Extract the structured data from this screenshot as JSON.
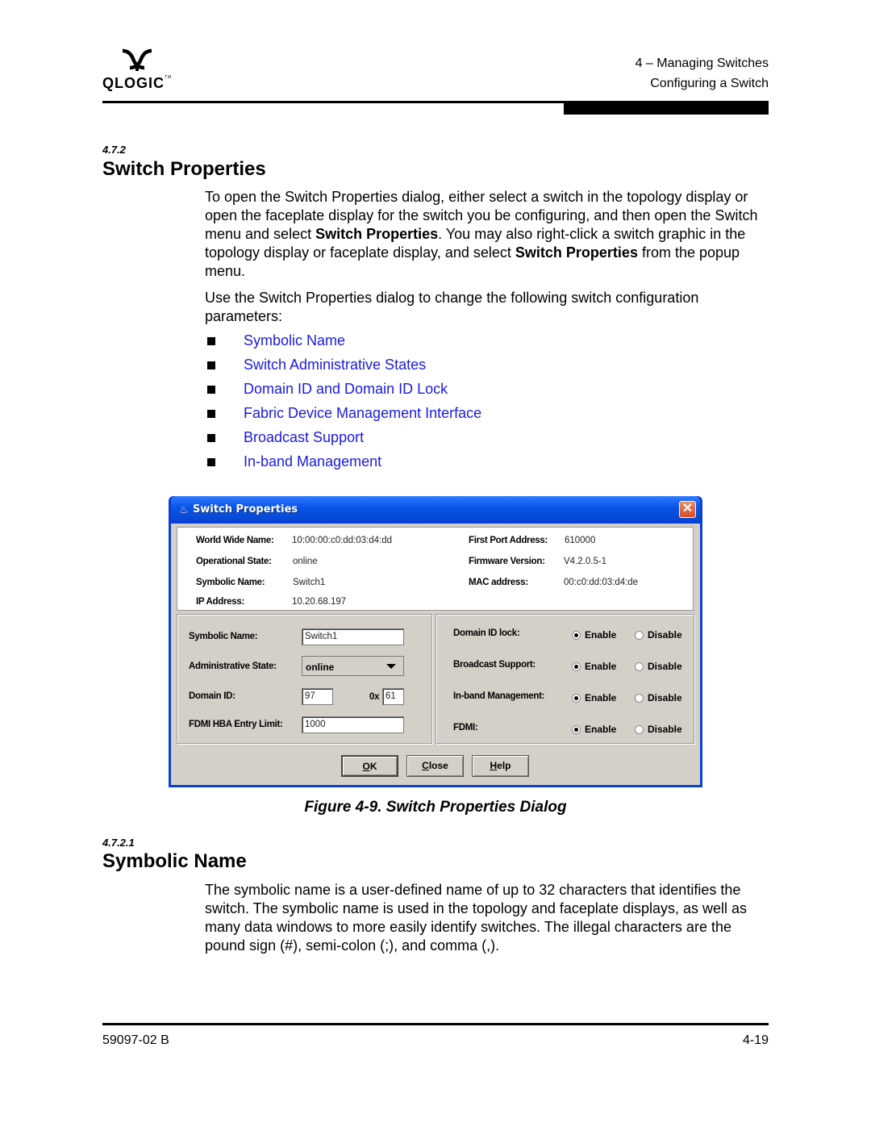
{
  "header": {
    "logo_text": "QLOGIC",
    "logo_tm": "TM",
    "chapter": "4 – Managing Switches",
    "section": "Configuring a Switch"
  },
  "section1": {
    "number": "4.7.2",
    "title": "Switch Properties",
    "para1": {
      "t1": "To open the Switch Properties dialog, either select a switch in the topology display or open the faceplate display for the switch you be configuring, and then open the Switch menu and select ",
      "b1": "Switch Properties",
      "t2": ". You may also right-click a switch graphic in the topology display or faceplate display, and select ",
      "b2": "Switch Properties",
      "t3": " from the popup menu."
    },
    "para2": "Use the Switch Properties dialog to change the following switch configuration parameters:",
    "links": [
      "Symbolic Name",
      "Switch Administrative States",
      "Domain ID and Domain ID Lock",
      "Fabric Device Management Interface",
      "Broadcast Support",
      "In-band Management"
    ],
    "link_color": "#1a1ae6"
  },
  "dialog": {
    "title": "Switch Properties",
    "info": {
      "wwn_label": "World Wide Name:",
      "wwn_value": "10:00:00:c0:dd:03:d4:dd",
      "opstate_label": "Operational State:",
      "opstate_value": "online",
      "symname_label": "Symbolic Name:",
      "symname_value": "Switch1",
      "ip_label": "IP Address:",
      "ip_value": "10.20.68.197",
      "fpa_label": "First Port Address:",
      "fpa_value": "610000",
      "fw_label": "Firmware Version:",
      "fw_value": "V4.2.0.5-1",
      "mac_label": "MAC address:",
      "mac_value": "00:c0:dd:03:d4:de"
    },
    "form": {
      "symname_label": "Symbolic Name:",
      "symname_value": "Switch1",
      "adminstate_label": "Administrative State:",
      "adminstate_value": "online",
      "domain_label": "Domain ID:",
      "domain_value": "97",
      "hex_prefix": "0x",
      "hex_value": "61",
      "fdmi_limit_label": "FDMI HBA Entry Limit:",
      "fdmi_limit_value": "1000"
    },
    "options": [
      {
        "label": "Domain ID lock:",
        "enable": "Enable",
        "disable": "Disable",
        "selected": "enable"
      },
      {
        "label": "Broadcast Support:",
        "enable": "Enable",
        "disable": "Disable",
        "selected": "enable"
      },
      {
        "label": "In-band Management:",
        "enable": "Enable",
        "disable": "Disable",
        "selected": "enable"
      },
      {
        "label": "FDMI:",
        "enable": "Enable",
        "disable": "Disable",
        "selected": "enable"
      }
    ],
    "buttons": {
      "ok_key": "O",
      "ok_rest": "K",
      "close_key": "C",
      "close_rest": "lose",
      "help_key": "H",
      "help_rest": "elp"
    }
  },
  "figure_caption": "Figure 4-9.  Switch Properties Dialog",
  "section2": {
    "number": "4.7.2.1",
    "title": "Symbolic Name",
    "para": "The symbolic name is a user-defined name of up to 32 characters that identifies the switch. The symbolic name is used in the topology and faceplate displays, as well as many data windows to more easily identify switches. The illegal characters are the pound sign (#), semi-colon (;), and comma (,)."
  },
  "footer": {
    "doc_number": "59097-02 B",
    "page_number": "4-19"
  }
}
